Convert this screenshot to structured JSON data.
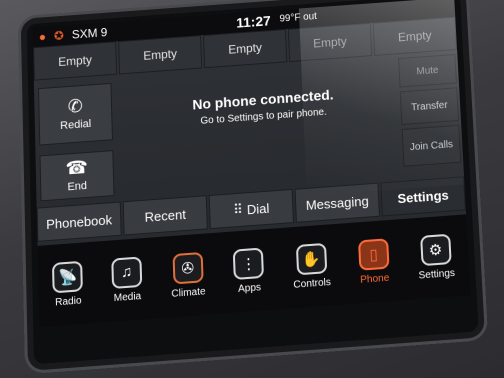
{
  "status_bar": {
    "radio_station": "SXM 9",
    "time": "11:27",
    "temperature": "99°F out"
  },
  "presets": [
    "Empty",
    "Empty",
    "Empty",
    "Empty",
    "Empty"
  ],
  "left_buttons": {
    "redial_label": "Redial",
    "end_label": "End"
  },
  "right_buttons": {
    "mute_label": "Mute",
    "transfer_label": "Transfer",
    "join_calls_label": "Join Calls"
  },
  "message": {
    "line1": "No phone connected.",
    "line2": "Go to Settings to pair phone."
  },
  "phone_tabs": {
    "phonebook": "Phonebook",
    "recent": "Recent",
    "dial": "Dial",
    "messaging": "Messaging",
    "settings": "Settings"
  },
  "nav": {
    "radio": "Radio",
    "media": "Media",
    "climate": "Climate",
    "apps": "Apps",
    "controls": "Controls",
    "phone": "Phone",
    "settings": "Settings"
  },
  "colors": {
    "accent_active": "#ff6a3a",
    "screen_bg": "#2a2d31"
  },
  "icons": {
    "redial": "phone-icon",
    "end": "hangup-icon",
    "dial": "keypad-icon"
  }
}
